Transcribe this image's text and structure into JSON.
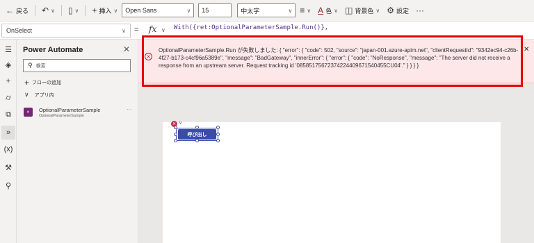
{
  "toolbar": {
    "back_label": "戻る",
    "insert_label": "挿入",
    "font_name": "Open Sans",
    "font_size": "15",
    "font_weight": "中太字",
    "color_label": "色",
    "fill_label": "背景色",
    "settings_label": "設定"
  },
  "formula_bar": {
    "property": "OnSelect",
    "equals": "=",
    "fx": "fx",
    "code": "With({ret:OptionalParameterSample.Run()},"
  },
  "panel": {
    "title": "Power Automate",
    "search_placeholder": "検索",
    "add_flow": "フローの追加",
    "section": "アプリ内",
    "flow_name": "OptionalParameterSample",
    "flow_sub": "OptionalParameterSample"
  },
  "error": {
    "message": "OptionalParameterSample.Run が失敗しました: { \"error\": { \"code\": 502, \"source\": \"japan-001.azure-apim.net\", \"clientRequestId\": \"9342ec94-c26b-4f27-b173-c4cf96a5389e\", \"message\": \"BadGateway\", \"innerError\": { \"error\": { \"code\": \"NoResponse\", \"message\": \"The server did not receive a response from an upstream server. Request tracking id '08585175672374224409671540455CU04'.\" } } } }"
  },
  "canvas": {
    "button_label": "呼び出し"
  },
  "colors": {
    "accent": "#3b4ba8",
    "error_bg": "#fde7e9",
    "highlight": "#e60000",
    "flow_icon": "#742774"
  }
}
